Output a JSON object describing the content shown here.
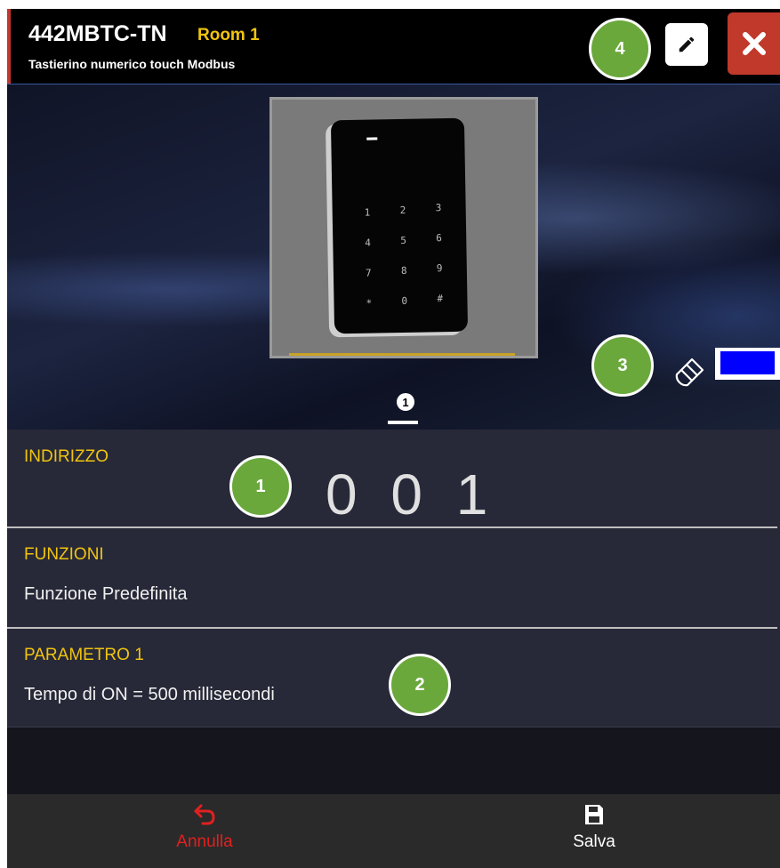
{
  "header": {
    "model": "442MBTC-TN",
    "room": "Room 1",
    "subtitle": "Tastierino numerico touch Modbus"
  },
  "image": {
    "keys": [
      "1",
      "2",
      "3",
      "4",
      "5",
      "6",
      "7",
      "8",
      "9",
      "*",
      "0",
      "#"
    ],
    "page_number": "1",
    "color_value": "#0000ff"
  },
  "sections": {
    "address": {
      "label": "INDIRIZZO",
      "value": "0 0 1"
    },
    "functions": {
      "label": "FUNZIONI",
      "value": "Funzione Predefinita"
    },
    "param1": {
      "label": "PARAMETRO 1",
      "value": "Tempo di ON = 500 millisecondi"
    }
  },
  "bottombar": {
    "cancel_label": "Annulla",
    "save_label": "Salva"
  },
  "annotations": [
    "1",
    "2",
    "3",
    "4"
  ],
  "colors": {
    "accent_yellow": "#f1c40f",
    "cancel_red": "#e02020",
    "close_red": "#c0392b",
    "badge_green": "#6aa83c"
  }
}
